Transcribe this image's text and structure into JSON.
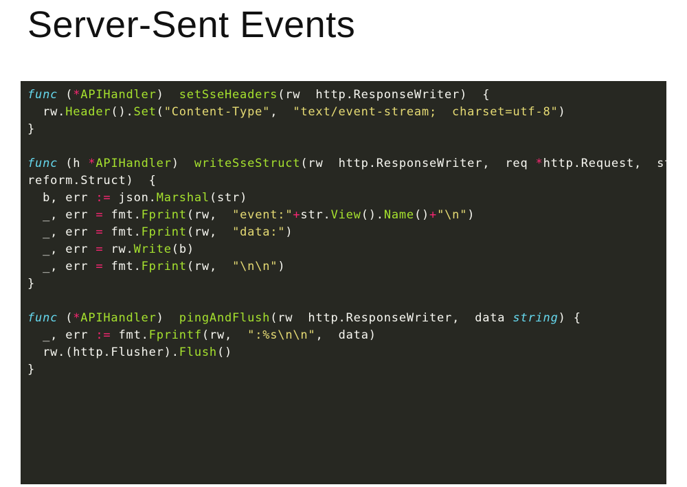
{
  "title": "Server-Sent Events",
  "c": {
    "func": "func",
    "star": "*",
    "APIHandler": "APIHandler",
    "setSseHeaders": "setSseHeaders",
    "rw": "rw",
    "http": "http",
    "ResponseWriter": "ResponseWriter",
    "Header": "Header",
    "Set": "Set",
    "ct": "\"Content-Type\"",
    "ctv": "\"text/event-stream;  charset=utf-8\"",
    "h": "h",
    "writeSseStruct": "writeSseStruct",
    "req": "req",
    "Request": "Request",
    "str_id": "str",
    "reform": "reform",
    "Struct": "Struct",
    "b": "b",
    "err": "err",
    "assign": ":=",
    "eq": "=",
    "plus": "+",
    "json": "json",
    "Marshal": "Marshal",
    "blank": "_",
    "fmt": "fmt",
    "Fprint": "Fprint",
    "evstr": "\"event:\"",
    "View": "View",
    "Name": "Name",
    "nl": "\"\\n\"",
    "datastr": "\"data:\"",
    "Write": "Write",
    "nlnl": "\"\\n\\n\"",
    "pingAndFlush": "pingAndFlush",
    "data": "data",
    "string_kw": "string",
    "Fprintf": "Fprintf",
    "fmtstr": "\":%s\\n\\n\"",
    "Flusher": "Flusher",
    "Flush": "Flush"
  }
}
